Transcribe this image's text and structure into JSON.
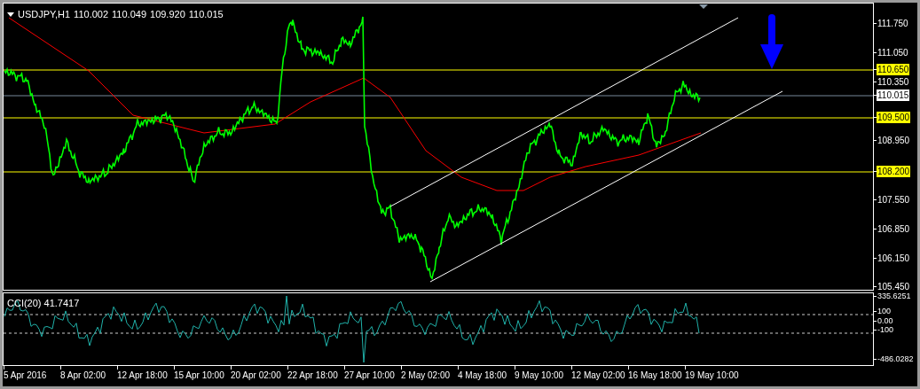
{
  "chart_header": {
    "symbol": "USDJPY,H1",
    "quotes": [
      "110.002",
      "110.049",
      "109.920",
      "110.015"
    ]
  },
  "price_scale": [
    {
      "label": "111.750",
      "kind": "tick"
    },
    {
      "label": "111.050",
      "kind": "tick"
    },
    {
      "label": "110.650",
      "kind": "level"
    },
    {
      "label": "110.350",
      "kind": "tick"
    },
    {
      "label": "110.015",
      "kind": "current"
    },
    {
      "label": "109.500",
      "kind": "level"
    },
    {
      "label": "108.950",
      "kind": "tick"
    },
    {
      "label": "108.200",
      "kind": "level"
    },
    {
      "label": "107.550",
      "kind": "tick"
    },
    {
      "label": "106.850",
      "kind": "tick"
    },
    {
      "label": "106.150",
      "kind": "tick"
    },
    {
      "label": "105.450",
      "kind": "tick"
    }
  ],
  "indicator": {
    "label": "CCI(20) 41.7417",
    "scale": [
      {
        "label": "335.6251",
        "kind": "tick"
      },
      {
        "label": "100",
        "kind": "level"
      },
      {
        "label": "0.00",
        "kind": "tick"
      },
      {
        "label": "-100",
        "kind": "level"
      },
      {
        "label": "-486.0282",
        "kind": "tick"
      }
    ]
  },
  "time_axis": [
    "5 Apr 2016",
    "8 Apr 02:00",
    "12 Apr 18:00",
    "15 Apr 10:00",
    "20 Apr 02:00",
    "22 Apr 18:00",
    "27 Apr 10:00",
    "2 May 02:00",
    "4 May 18:00",
    "9 May 10:00",
    "12 May 02:00",
    "16 May 18:00",
    "19 May 10:00"
  ]
}
